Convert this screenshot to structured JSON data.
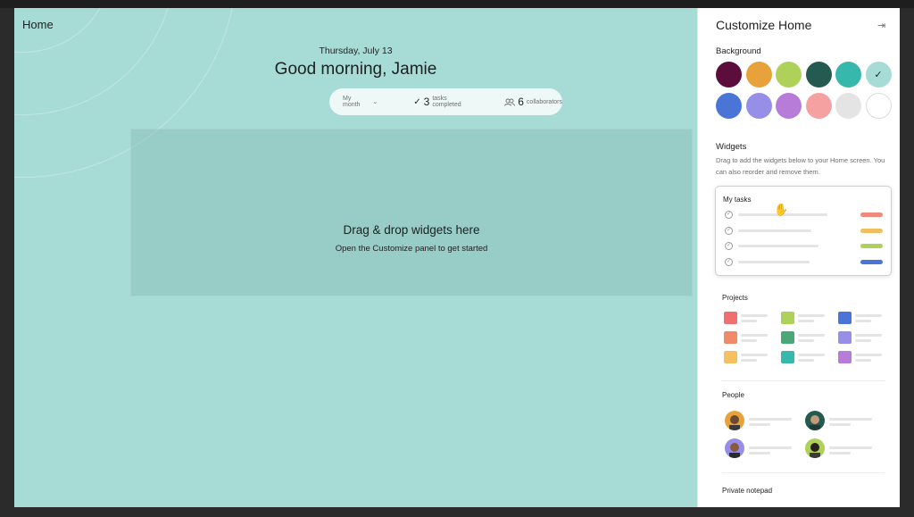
{
  "home": {
    "title": "Home",
    "date": "Thursday, July 13",
    "greeting": "Good morning, Jamie",
    "stats": {
      "period": "My month",
      "tasks_count": "3",
      "tasks_label": "tasks completed",
      "collab_count": "6",
      "collab_label": "collaborators"
    },
    "dropzone": {
      "title": "Drag & drop widgets here",
      "subtitle": "Open the Customize panel to get started"
    }
  },
  "panel": {
    "title": "Customize Home",
    "background_label": "Background",
    "colors": [
      "#5c0d3c",
      "#e8a23b",
      "#aed15a",
      "#245a4f",
      "#36b8ac",
      "#a7dcd6",
      "#4a75d6",
      "#978ee8",
      "#b67cd8",
      "#f5a1a1",
      "#e4e4e4",
      "#ffffff"
    ],
    "selected_color": "#a7dcd6",
    "widgets_label": "Widgets",
    "widgets_help": "Drag to add the widgets below to your Home screen. You can also reorder and remove them.",
    "widgets": {
      "my_tasks": "My tasks",
      "projects": "Projects",
      "people": "People",
      "notepad": "Private notepad"
    },
    "task_colors": [
      "#f08a7a",
      "#f0c060",
      "#aed15a",
      "#4a75d6"
    ],
    "project_colors": [
      "#f07070",
      "#aed15a",
      "#4a75d6",
      "#f08a6a",
      "#4aa878",
      "#978ee8",
      "#f5c060",
      "#36b8ac",
      "#b67cd8"
    ]
  }
}
